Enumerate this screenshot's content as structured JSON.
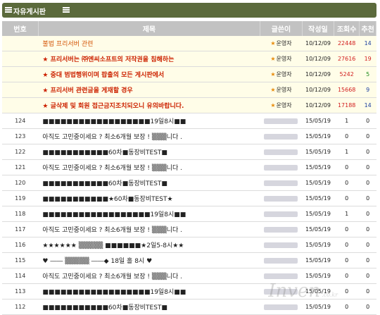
{
  "board": {
    "title": "자유게시판"
  },
  "columns": [
    "번호",
    "제목",
    "글쓴이",
    "작성일",
    "조회수",
    "추천"
  ],
  "notices": [
    {
      "num": "",
      "title": "불법 프리서버 관련",
      "author": "운영자",
      "date": "10/12/09",
      "views": "22448",
      "rec": "14",
      "rec_color": "blue",
      "plain": true
    },
    {
      "num": "",
      "title": "★ 프리서버는 ㈜엔씨소프트의 저작권을 침해하는",
      "author": "운영자",
      "date": "10/12/09",
      "views": "27616",
      "rec": "19",
      "rec_color": "red"
    },
    {
      "num": "",
      "title": "★ 중대 범법행위이며 팝출의 모든 게시판에서",
      "author": "운영자",
      "date": "10/12/09",
      "views": "5242",
      "rec": "5",
      "rec_color": "green"
    },
    {
      "num": "",
      "title": "★ 프리서버 관련글을 게재할 경우",
      "author": "운영자",
      "date": "10/12/09",
      "views": "15668",
      "rec": "9",
      "rec_color": "blue"
    },
    {
      "num": "",
      "title": "★ 글삭제 및 회원 접근금지조치되오니 유의바랍니다.",
      "author": "운영자",
      "date": "10/12/09",
      "views": "17188",
      "rec": "14",
      "rec_color": "blue"
    }
  ],
  "posts": [
    {
      "num": "124",
      "title": "■■■■■■■■■■■■■■■■■■19일8시■■",
      "date": "15/05/19",
      "views": "1",
      "rec": "0"
    },
    {
      "num": "123",
      "title": "아직도 고민중이세요 ? 최소6개월 보장 ! ▒▒▒니다 .",
      "date": "15/05/19",
      "views": "0",
      "rec": "0"
    },
    {
      "num": "122",
      "title": "■■■■■■■■■■■60차■동장비TEST■",
      "date": "15/05/19",
      "views": "1",
      "rec": "0"
    },
    {
      "num": "121",
      "title": "아직도 고민중이세요 ? 최소6개월 보장 ! ▒▒▒니다 .",
      "date": "15/05/19",
      "views": "0",
      "rec": "0"
    },
    {
      "num": "120",
      "title": "■■■■■■■■■■■60차■동장비TEST■",
      "date": "15/05/19",
      "views": "0",
      "rec": "0"
    },
    {
      "num": "119",
      "title": "■■■■■■■■■■■★60차■동장비TEST★",
      "date": "15/05/19",
      "views": "0",
      "rec": "0"
    },
    {
      "num": "118",
      "title": "■■■■■■■■■■■■■■■■■■19일8시■■",
      "date": "15/05/19",
      "views": "1",
      "rec": "0"
    },
    {
      "num": "117",
      "title": "아직도 고민중이세요 ? 최소6개월 보장 ! ▒▒▒니다 .",
      "date": "15/05/19",
      "views": "0",
      "rec": "0"
    },
    {
      "num": "116",
      "title": "★★★★★★   ▒▒▒▒▒   ■■■■■■★2일5-8시★★",
      "date": "15/05/19",
      "views": "0",
      "rec": "0"
    },
    {
      "num": "115",
      "title": "♥ ―― ▒▒▒▒▒ ――◆ 18일 홀 8시 ♥",
      "date": "15/05/19",
      "views": "0",
      "rec": "0"
    },
    {
      "num": "114",
      "title": "아직도 고민중이세요 ? 최소6개월 보장 ! ▒▒▒니다 .",
      "date": "15/05/19",
      "views": "0",
      "rec": "0"
    },
    {
      "num": "113",
      "title": "■■■■■■■■■■■■■■■■■■19일8시■■",
      "date": "15/05/19",
      "views": "0",
      "rec": "0"
    },
    {
      "num": "112",
      "title": "■■■■■■■■■■■60차■동장비TEST■",
      "date": "15/05/19",
      "views": "0",
      "rec": "0"
    }
  ],
  "watermark": "Inven",
  "watermark_sub": ".co.kr"
}
